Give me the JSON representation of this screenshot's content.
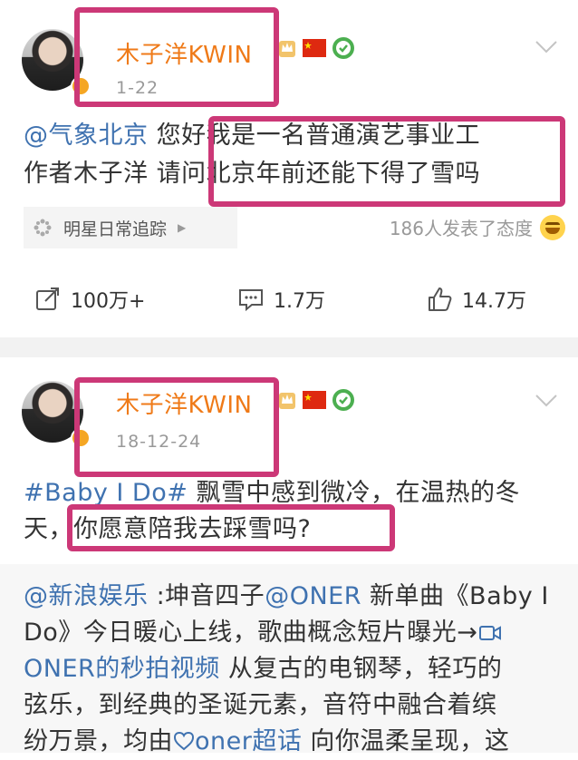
{
  "posts": [
    {
      "author": "木子洋KWIN",
      "date": "1-22",
      "body_line1_mention": "@气象北京",
      "body_line1_rest": " 您好我是一名普通演艺事业工",
      "body_line2": "作者木子洋 请问北京年前还能下得了雪吗",
      "topic_card": "明星日常追踪",
      "reactions": "186人发表了态度",
      "actions": {
        "repost": "100万+",
        "comment": "1.7万",
        "like": "14.7万"
      }
    },
    {
      "author": "木子洋KWIN",
      "date": "18-12-24",
      "body_line1_hashtag": "#Baby I Do#",
      "body_line1_rest": " 飘雪中感到微冷，在温热的冬",
      "body_line2": "天，你愿意陪我去踩雪吗?",
      "repost": {
        "line1_mention": "@新浪娱乐",
        "line1_rest": " :坤音四子",
        "line1_mention2": "@ONER",
        "line1_rest2": " 新单曲《Baby I",
        "line2": "Do》今日暖心上线，歌曲概念短片曝光→",
        "line3_link": "ONER的秒拍视频",
        "line3_rest": " 从复古的电钢琴，轻巧的",
        "line4": "弦乐，到经典的圣诞元素，音符中融合着缤",
        "line5_a": "纷万景，均由",
        "line5_link": "oner超话",
        "line5_b": " 向你温柔呈现，这"
      }
    }
  ],
  "colors": {
    "name": "#ef7a18",
    "link": "#3f72b0",
    "highlight": "#cc3877",
    "badge": "#f5a623"
  },
  "icons": [
    "crown-icon",
    "china-flag-icon",
    "verified-check-icon",
    "chevron-down-icon",
    "repost-icon",
    "comment-icon",
    "like-icon",
    "topic-icon",
    "video-icon",
    "supertopic-icon"
  ]
}
